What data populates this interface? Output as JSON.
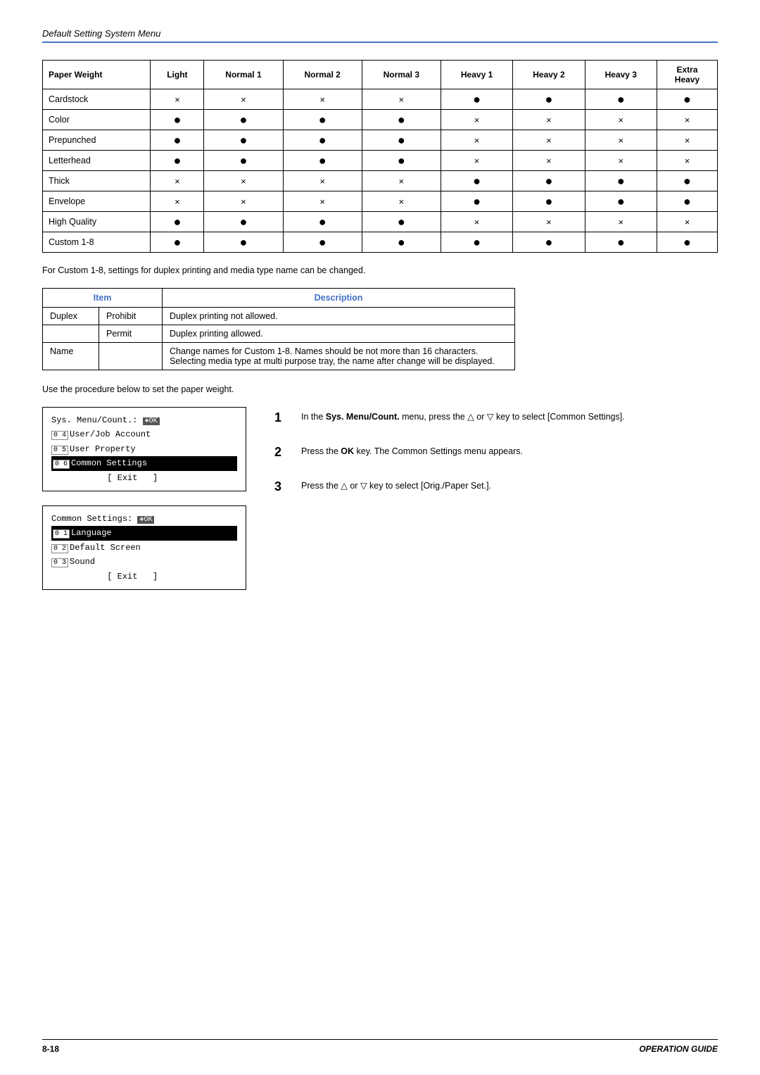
{
  "header": {
    "title": "Default Setting System Menu"
  },
  "pw_table": {
    "columns": [
      {
        "key": "paper_weight",
        "label": "Paper Weight"
      },
      {
        "key": "light",
        "label": "Light"
      },
      {
        "key": "normal1",
        "label": "Normal 1"
      },
      {
        "key": "normal2",
        "label": "Normal 2"
      },
      {
        "key": "normal3",
        "label": "Normal 3"
      },
      {
        "key": "heavy1",
        "label": "Heavy 1"
      },
      {
        "key": "heavy2",
        "label": "Heavy 2"
      },
      {
        "key": "heavy3",
        "label": "Heavy 3"
      },
      {
        "key": "extra_heavy",
        "label": "Extra Heavy"
      }
    ],
    "rows": [
      {
        "label": "Cardstock",
        "values": [
          "x",
          "x",
          "x",
          "x",
          "●",
          "●",
          "●",
          "●"
        ]
      },
      {
        "label": "Color",
        "values": [
          "●",
          "●",
          "●",
          "●",
          "x",
          "x",
          "x",
          "x"
        ]
      },
      {
        "label": "Prepunched",
        "values": [
          "●",
          "●",
          "●",
          "●",
          "x",
          "x",
          "x",
          "x"
        ]
      },
      {
        "label": "Letterhead",
        "values": [
          "●",
          "●",
          "●",
          "●",
          "x",
          "x",
          "x",
          "x"
        ]
      },
      {
        "label": "Thick",
        "values": [
          "x",
          "x",
          "x",
          "x",
          "●",
          "●",
          "●",
          "●"
        ]
      },
      {
        "label": "Envelope",
        "values": [
          "x",
          "x",
          "x",
          "x",
          "●",
          "●",
          "●",
          "●"
        ]
      },
      {
        "label": "High Quality",
        "values": [
          "●",
          "●",
          "●",
          "●",
          "x",
          "x",
          "x",
          "x"
        ]
      },
      {
        "label": "Custom 1-8",
        "values": [
          "●",
          "●",
          "●",
          "●",
          "●",
          "●",
          "●",
          "●"
        ]
      }
    ]
  },
  "caption": "For Custom 1-8, settings for duplex printing and media type name can be changed.",
  "id_table": {
    "col_item": "Item",
    "col_desc": "Description",
    "rows": [
      {
        "item": "Duplex",
        "sub": "Prohibit",
        "desc": "Duplex printing not allowed."
      },
      {
        "item": "",
        "sub": "Permit",
        "desc": "Duplex printing allowed."
      },
      {
        "item": "Name",
        "sub": "",
        "desc": "Change names for Custom 1-8. Names should be not more than 16 characters. Selecting media type at multi purpose tray, the name after change will be displayed."
      }
    ]
  },
  "procedure_text": "Use the procedure below to set the paper weight.",
  "screen1": {
    "lines": [
      {
        "text": "Sys. Menu/Count.: ",
        "suffix": "OK",
        "type": "normal"
      },
      {
        "text": "04 User/Job Account",
        "type": "normal"
      },
      {
        "text": "05 User Property",
        "type": "normal"
      },
      {
        "text": "06 Common Settings",
        "type": "highlighted"
      },
      {
        "text": "            [ Exit ]",
        "type": "normal"
      }
    ]
  },
  "screen2": {
    "lines": [
      {
        "text": "Common Settings: ",
        "suffix": "OK",
        "type": "normal"
      },
      {
        "text": "01 Language",
        "type": "highlighted"
      },
      {
        "text": "02 Default Screen",
        "type": "normal"
      },
      {
        "text": "03 Sound",
        "type": "normal"
      },
      {
        "text": "            [ Exit ]",
        "type": "normal"
      }
    ]
  },
  "steps": [
    {
      "num": "1",
      "text": "In the Sys. Menu/Count. menu, press the △ or ▽ key to select [Common Settings]."
    },
    {
      "num": "2",
      "text": "Press the OK key. The Common Settings menu appears."
    },
    {
      "num": "3",
      "text": "Press the △ or ▽ key to select [Orig./Paper Set.]."
    }
  ],
  "footer": {
    "page": "8-18",
    "guide": "OPERATION GUIDE"
  }
}
